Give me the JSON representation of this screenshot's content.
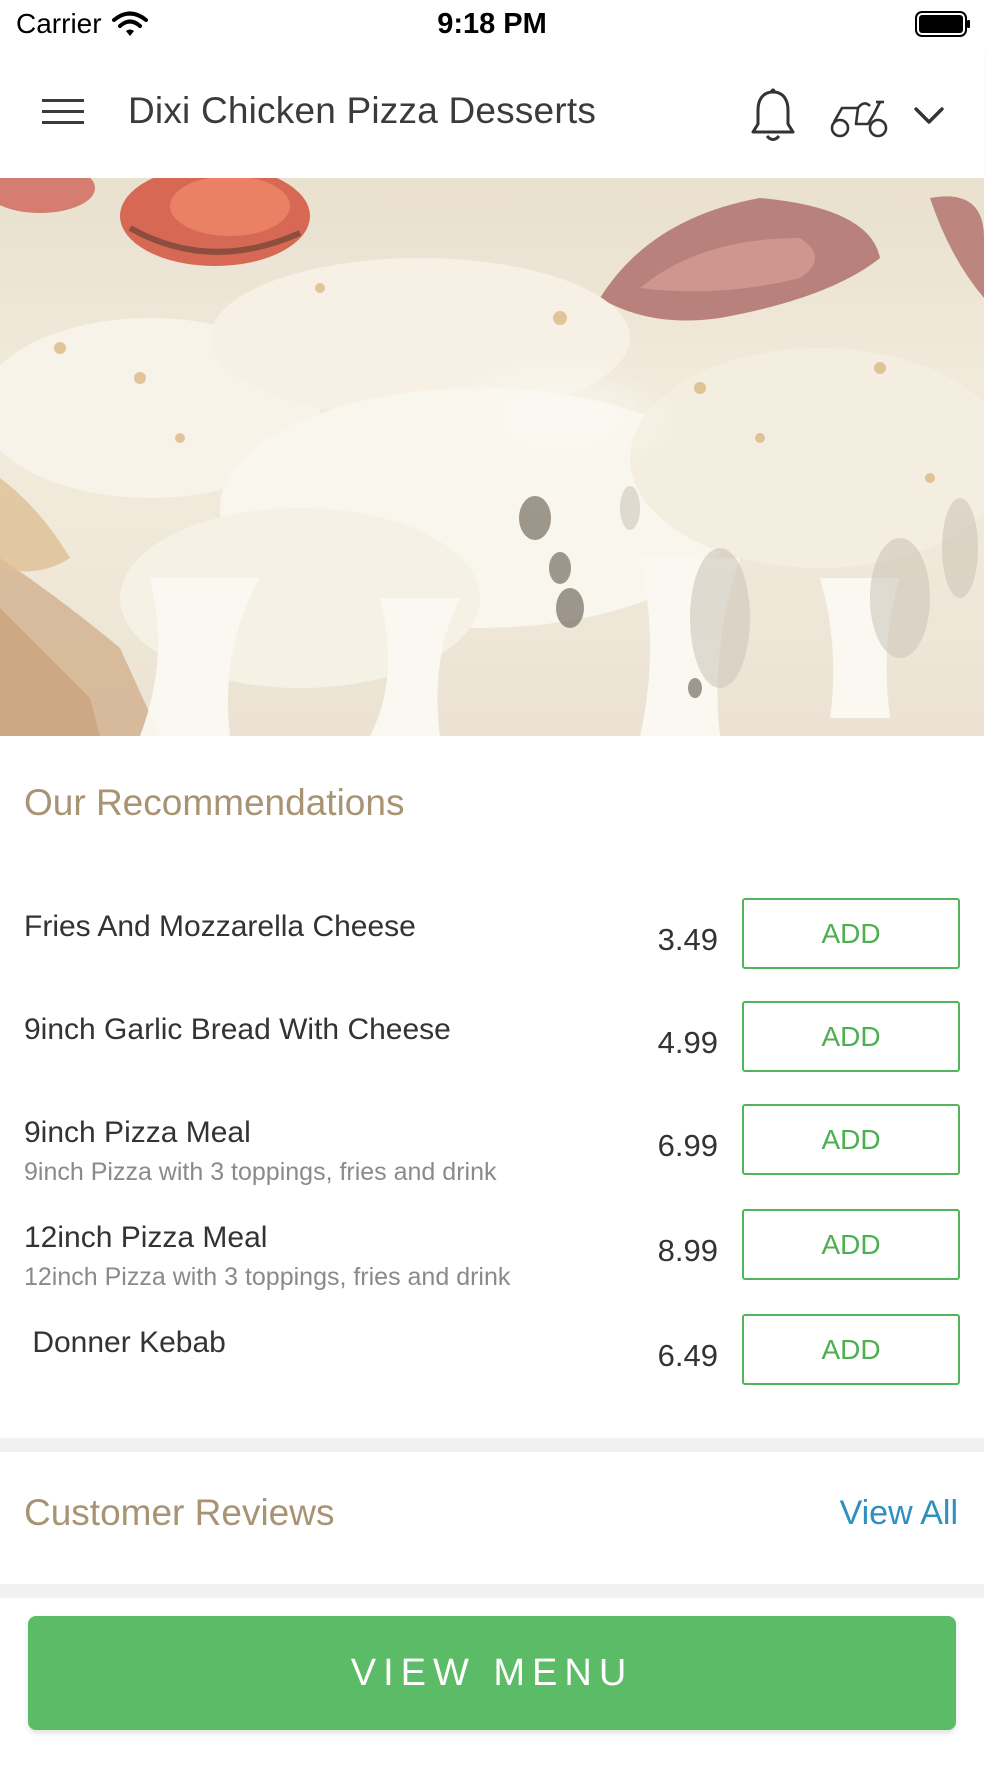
{
  "status_bar": {
    "carrier": "Carrier",
    "time": "9:18 PM"
  },
  "header": {
    "title": "Dixi Chicken Pizza Desserts"
  },
  "hero": {
    "alt": "Pizza"
  },
  "recommendations": {
    "title": "Our Recommendations",
    "add_label": "ADD",
    "items": [
      {
        "name": "Fries And Mozzarella Cheese",
        "description": "",
        "price": "3.49",
        "add_label": "ADD"
      },
      {
        "name": "9inch Garlic Bread With Cheese",
        "description": "",
        "price": "4.99",
        "add_label": "ADD"
      },
      {
        "name": "9inch Pizza Meal",
        "description": "9inch Pizza with 3 toppings, fries and drink",
        "price": "6.99",
        "add_label": "ADD"
      },
      {
        "name": "12inch Pizza Meal",
        "description": "12inch Pizza with 3 toppings, fries and drink",
        "price": "8.99",
        "add_label": "ADD"
      },
      {
        "name": " Donner Kebab",
        "description": "",
        "price": "6.49",
        "add_label": "ADD"
      }
    ]
  },
  "reviews": {
    "title": "Customer Reviews",
    "view_all": "View All"
  },
  "bottom": {
    "view_menu": "VIEW MENU"
  },
  "colors": {
    "accent_green": "#5bbb66",
    "section_title": "#a89373",
    "link_blue": "#2e8fc0"
  },
  "icons": [
    "wifi-icon",
    "battery-icon",
    "hamburger-menu-icon",
    "bell-icon",
    "scooter-icon",
    "chevron-down-icon"
  ]
}
